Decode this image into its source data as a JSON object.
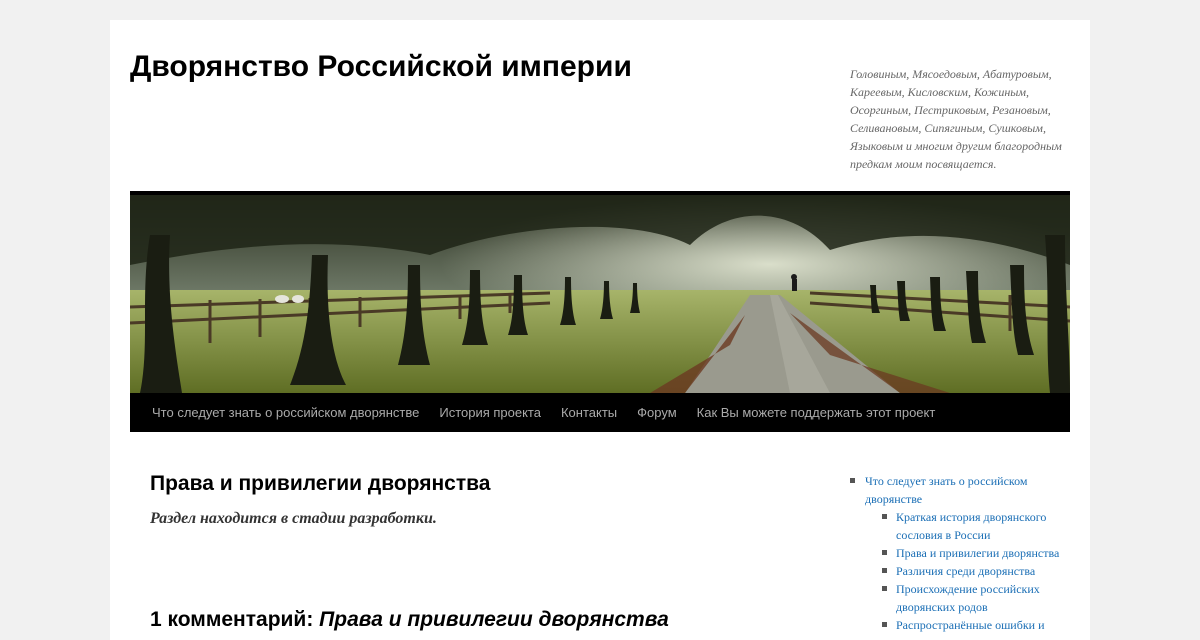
{
  "site": {
    "title": "Дворянство Российской империи",
    "description": "Головиным, Мясоедовым, Абатуровым, Кареевым, Кисловским, Кожиным, Осоргиным, Пестриковым, Резановым, Селивановым, Сипягиным, Сушковым, Языковым и многим другим благородным предкам моим посвящается."
  },
  "nav": {
    "items": [
      {
        "label": "Что следует знать о российском дворянстве"
      },
      {
        "label": "История проекта"
      },
      {
        "label": "Контакты"
      },
      {
        "label": "Форум"
      },
      {
        "label": "Как Вы можете поддержать этот проект"
      }
    ]
  },
  "article": {
    "title": "Права и привилегии дворянства",
    "note": "Раздел находится в стадии разработки.",
    "comments_prefix": "1 комментарий: ",
    "comments_post": "Права и привилегии дворянства"
  },
  "sidebar": {
    "top": "Что следует знать о российском дворянстве",
    "sub": [
      "Краткая история дворянского сословия в России",
      "Права и привилегии дворянства",
      "Различия среди дворянства",
      "Происхождение российских дворянских родов",
      "Распространённые ошибки и"
    ]
  },
  "colors": {
    "link": "#1a6eb5",
    "nav_bg": "#000000",
    "page_bg": "#f1f1f1"
  }
}
